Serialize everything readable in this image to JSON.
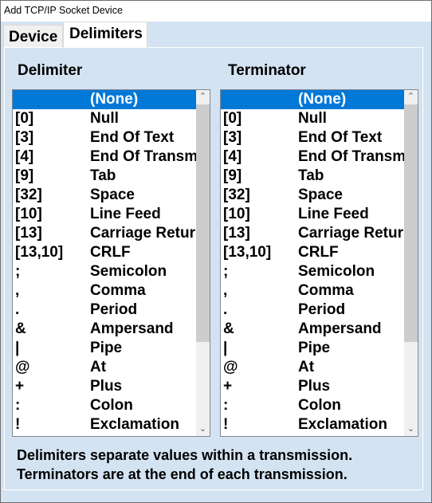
{
  "window": {
    "title": "Add TCP/IP Socket Device"
  },
  "tabs": [
    {
      "label": "Device",
      "active": false
    },
    {
      "label": "Delimiters",
      "active": true
    }
  ],
  "delimiter": {
    "header": "Delimiter",
    "selected": "(None)"
  },
  "terminator": {
    "header": "Terminator",
    "selected": "(None)"
  },
  "items": [
    {
      "code": "",
      "name": "(None)"
    },
    {
      "code": "[0]",
      "name": "Null"
    },
    {
      "code": "[3]",
      "name": "End Of Text"
    },
    {
      "code": "[4]",
      "name": "End Of Transmission"
    },
    {
      "code": "[9]",
      "name": "Tab"
    },
    {
      "code": "[32]",
      "name": "Space"
    },
    {
      "code": "[10]",
      "name": "Line Feed"
    },
    {
      "code": "[13]",
      "name": "Carriage Return"
    },
    {
      "code": "[13,10]",
      "name": "CRLF"
    },
    {
      "code": ";",
      "name": "Semicolon"
    },
    {
      "code": ",",
      "name": "Comma"
    },
    {
      "code": ".",
      "name": "Period"
    },
    {
      "code": "&",
      "name": "Ampersand"
    },
    {
      "code": "|",
      "name": "Pipe"
    },
    {
      "code": "@",
      "name": "At"
    },
    {
      "code": "+",
      "name": "Plus"
    },
    {
      "code": ":",
      "name": "Colon"
    },
    {
      "code": "!",
      "name": "Exclamation"
    }
  ],
  "scroll": {
    "position": 0
  },
  "footer": {
    "line1": "Delimiters separate values within a transmission.",
    "line2": "Terminators are at the end of each transmission."
  },
  "colors": {
    "selection": "#0078d7",
    "panel": "#d4e3f2"
  }
}
